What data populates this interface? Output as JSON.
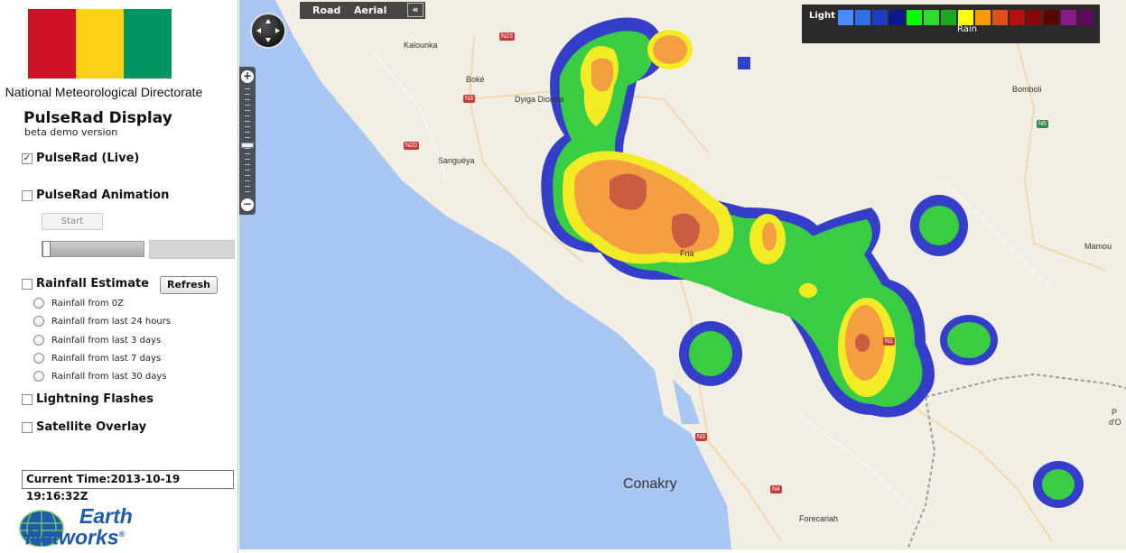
{
  "sidebar": {
    "flag_colors": [
      "#ce1126",
      "#fcd116",
      "#009460"
    ],
    "org": "National Meteorological Directorate",
    "title": "PulseRad Display",
    "subtitle": "beta demo version",
    "live": {
      "label": "PulseRad (Live)",
      "checked": true
    },
    "animation": {
      "label": "PulseRad Animation",
      "checked": false,
      "start_label": "Start"
    },
    "rainfall": {
      "label": "Rainfall Estimate",
      "checked": false,
      "refresh_label": "Refresh",
      "options": [
        "Rainfall from 0Z",
        "Rainfall from last 24 hours",
        "Rainfall from last 3 days",
        "Rainfall from last 7 days",
        "Rainfall from last 30 days"
      ]
    },
    "lightning": {
      "label": "Lightning Flashes",
      "checked": false
    },
    "satellite": {
      "label": "Satellite Overlay",
      "checked": false
    },
    "current_time": "Current Time:2013-10-19 19:16:32Z",
    "logo": {
      "line1": "Earth",
      "line2": "Networks",
      "trademark": "®"
    }
  },
  "map": {
    "maptype": {
      "road": "Road",
      "aerial": "Aerial",
      "collapse": "«"
    },
    "legend": {
      "light_label": "Light",
      "rain_label": "Rain",
      "swatches": [
        "#4a8cff",
        "#2e6fe6",
        "#1a3fc4",
        "#0a1a8c",
        "#00ff00",
        "#2ddc2d",
        "#1fa81f",
        "#ffff00",
        "#ff9900",
        "#e0501a",
        "#b81010",
        "#8a0808",
        "#5c0505",
        "#8a1a8a",
        "#5c0a5c"
      ]
    },
    "labels": {
      "kalounka": "Kalounka",
      "boke": "Boké",
      "dyiga": "Dyiga Diorata",
      "sanugeya": "Sanguéya",
      "bomboli": "Bomboli",
      "fria": "Fria",
      "mamou": "Mamou",
      "conakry": "Conakry",
      "forecariah": "Forecariah",
      "pdu": "P",
      "pdu2": "d'O"
    },
    "shields": {
      "n23": "N23",
      "n3a": "N3",
      "n20": "N20",
      "n5": "N5",
      "n1": "N1",
      "n3b": "N3",
      "n4": "N4"
    }
  }
}
